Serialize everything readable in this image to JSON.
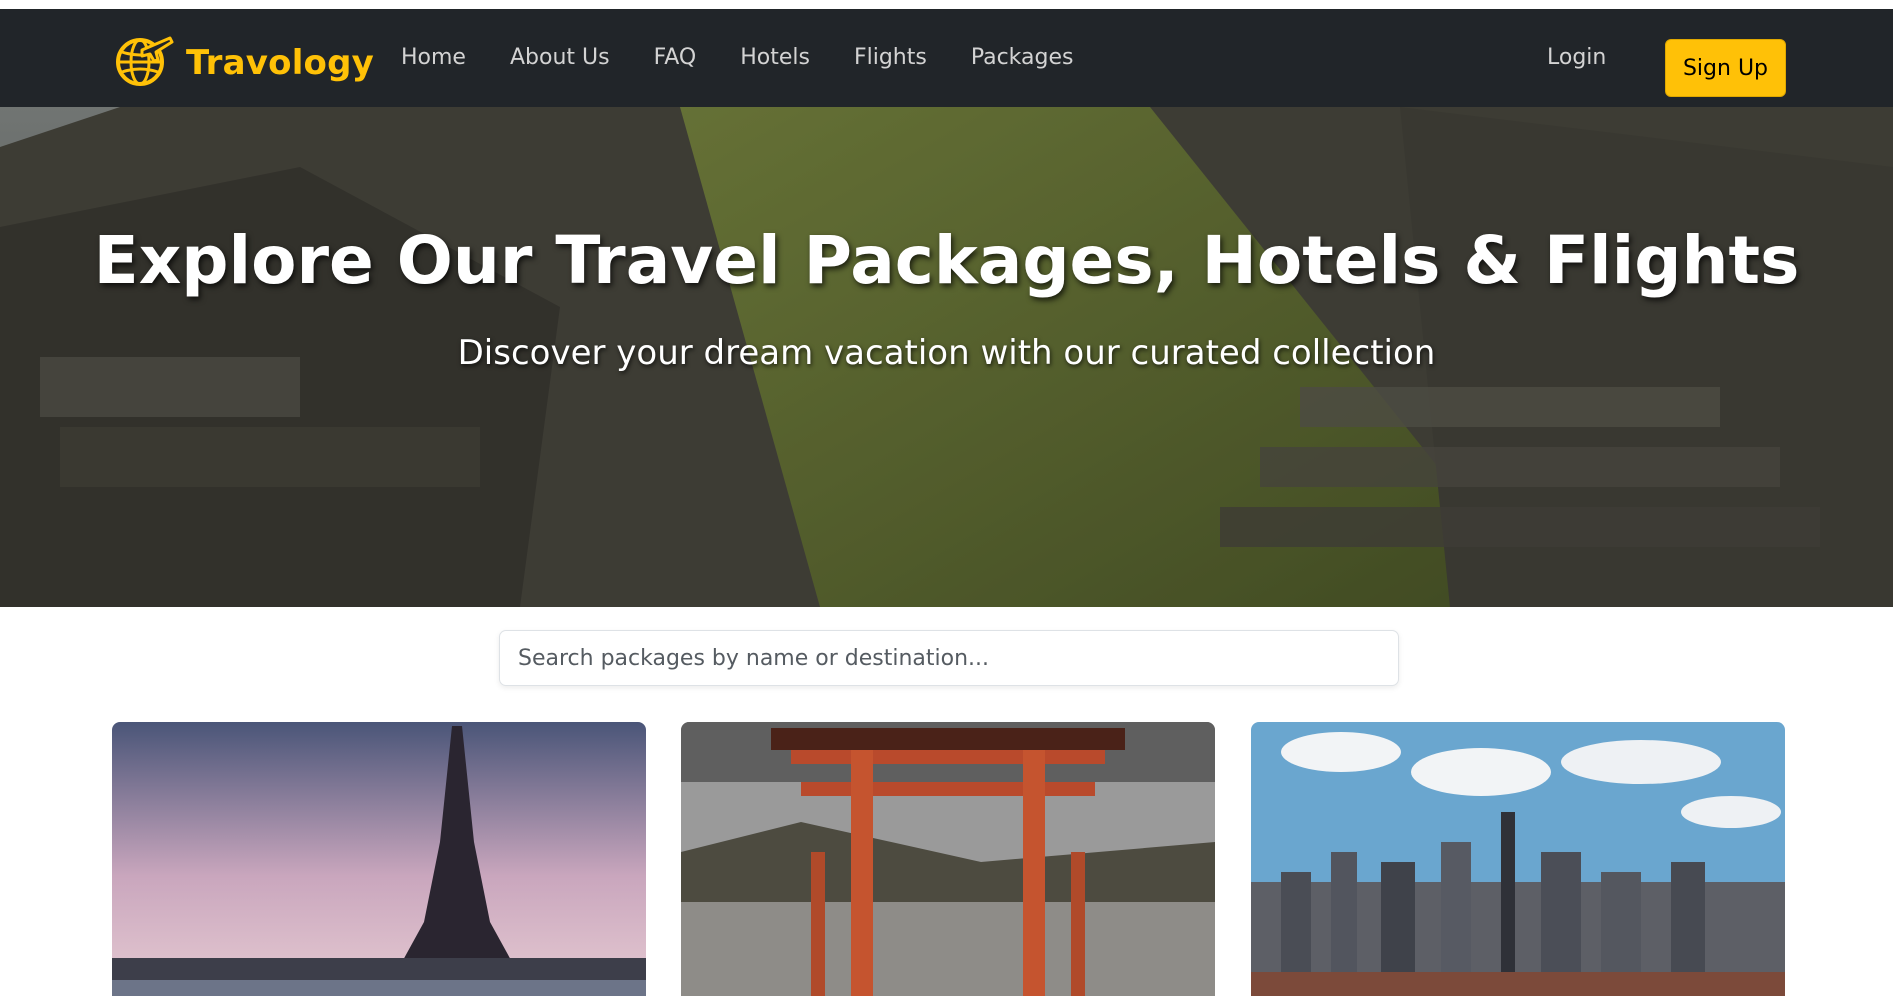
{
  "brand": {
    "name": "Travology",
    "logo_icon": "globe-plane-icon",
    "accent": "#ffc107"
  },
  "nav": {
    "items": [
      {
        "label": "Home"
      },
      {
        "label": "About Us"
      },
      {
        "label": "FAQ"
      },
      {
        "label": "Hotels"
      },
      {
        "label": "Flights"
      },
      {
        "label": "Packages"
      }
    ],
    "login_label": "Login",
    "signup_label": "Sign Up"
  },
  "hero": {
    "title": "Explore Our Travel Packages, Hotels & Flights",
    "subtitle": "Discover your dream vacation with our curated collection"
  },
  "search": {
    "placeholder": "Search packages by name or destination..."
  },
  "packages": [
    {
      "image": "eiffel-tower-photo"
    },
    {
      "image": "torii-gate-photo"
    },
    {
      "image": "city-skyline-photo"
    }
  ]
}
